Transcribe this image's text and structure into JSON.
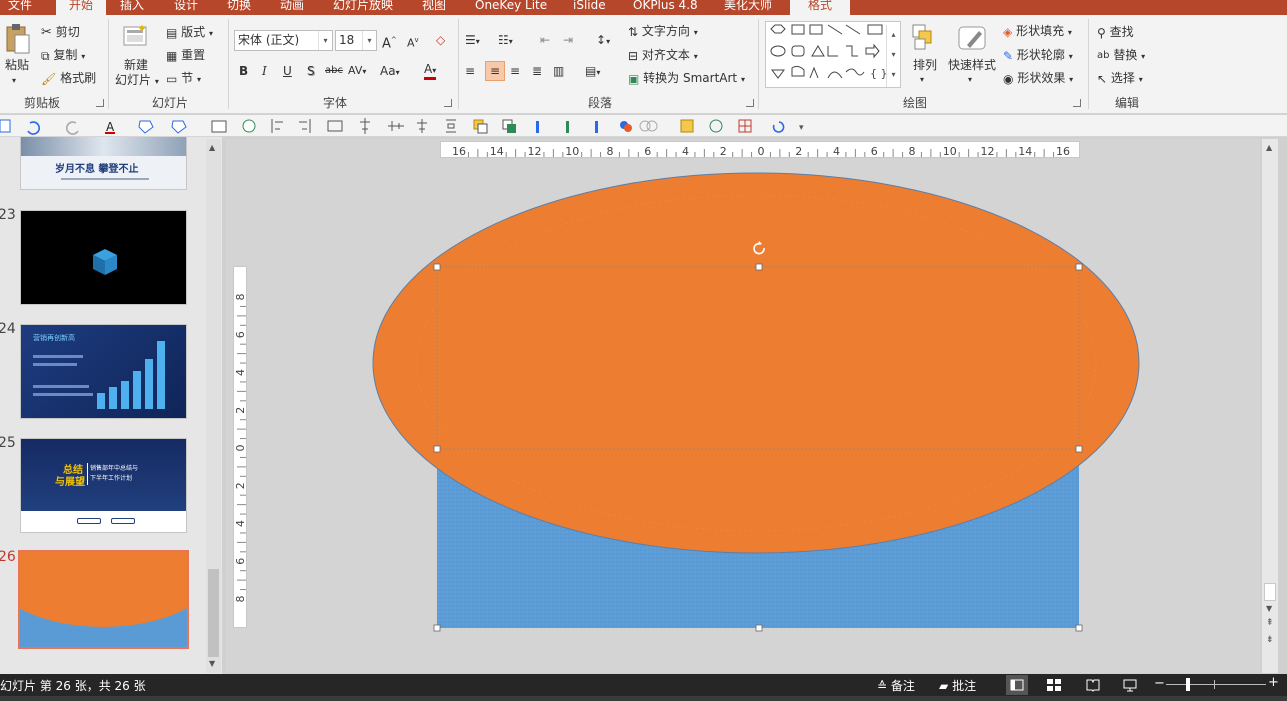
{
  "tabs": [
    {
      "label": "文件",
      "active": false
    },
    {
      "label": "开始",
      "active": true
    },
    {
      "label": "插入",
      "active": false
    },
    {
      "label": "设计",
      "active": false
    },
    {
      "label": "切换",
      "active": false
    },
    {
      "label": "动画",
      "active": false
    },
    {
      "label": "幻灯片放映",
      "active": false
    },
    {
      "label": "视图",
      "active": false
    },
    {
      "label": "OneKey Lite",
      "active": false
    },
    {
      "label": "iSlide",
      "active": false
    },
    {
      "label": "OKPlus 4.8",
      "active": false
    },
    {
      "label": "美化大师",
      "active": false
    },
    {
      "label": "格式",
      "active": false
    }
  ],
  "ribbon": {
    "clipboard": {
      "group": "剪贴板",
      "paste": "粘贴",
      "cut": "剪切",
      "copy": "复制",
      "format_painter": "格式刷"
    },
    "slides": {
      "group": "幻灯片",
      "new_slide_1": "新建",
      "new_slide_2": "幻灯片",
      "layout": "版式",
      "reset": "重置",
      "section": "节"
    },
    "font": {
      "group": "字体",
      "font_name": "宋体 (正文)",
      "font_size": "18"
    },
    "paragraph": {
      "group": "段落",
      "text_direction": "文字方向",
      "align_text": "对齐文本",
      "smartart": "转换为 SmartArt"
    },
    "drawing": {
      "group": "绘图",
      "arrange": "排列",
      "quick_styles": "快速样式",
      "shape_fill": "形状填充",
      "shape_outline": "形状轮廓",
      "shape_effects": "形状效果"
    },
    "editing": {
      "group": "编辑",
      "find": "查找",
      "replace": "替换",
      "select": "选择"
    }
  },
  "ruler": {
    "h_ticks": [
      "16",
      "14",
      "12",
      "10",
      "8",
      "6",
      "4",
      "2",
      "0",
      "2",
      "4",
      "6",
      "8",
      "10",
      "12",
      "14",
      "16"
    ],
    "v_ticks": [
      "8",
      "6",
      "4",
      "2",
      "0",
      "2",
      "4",
      "6",
      "8"
    ]
  },
  "slides": [
    {
      "number": "",
      "title": "岁月不息 攀登不止"
    },
    {
      "number": "23",
      "title": ""
    },
    {
      "number": "24",
      "title": "营销再创新高"
    },
    {
      "number": "25",
      "title_a": "总结",
      "title_b": "与展望",
      "subtitle_a": "销售部年中总结与",
      "subtitle_b": "下半年工作计划"
    },
    {
      "number": "26",
      "title": ""
    }
  ],
  "colors": {
    "accent_tab": "#b7472a",
    "ellipse_fill": "#ed7d31",
    "rect_fill": "#5b9bd5",
    "selected_thumb_border": "#e8745a",
    "selected_num": "#c0392b"
  },
  "status": {
    "slide_info": "幻灯片 第 26 张，共 26 张",
    "notes": "备注",
    "comments": "批注"
  }
}
